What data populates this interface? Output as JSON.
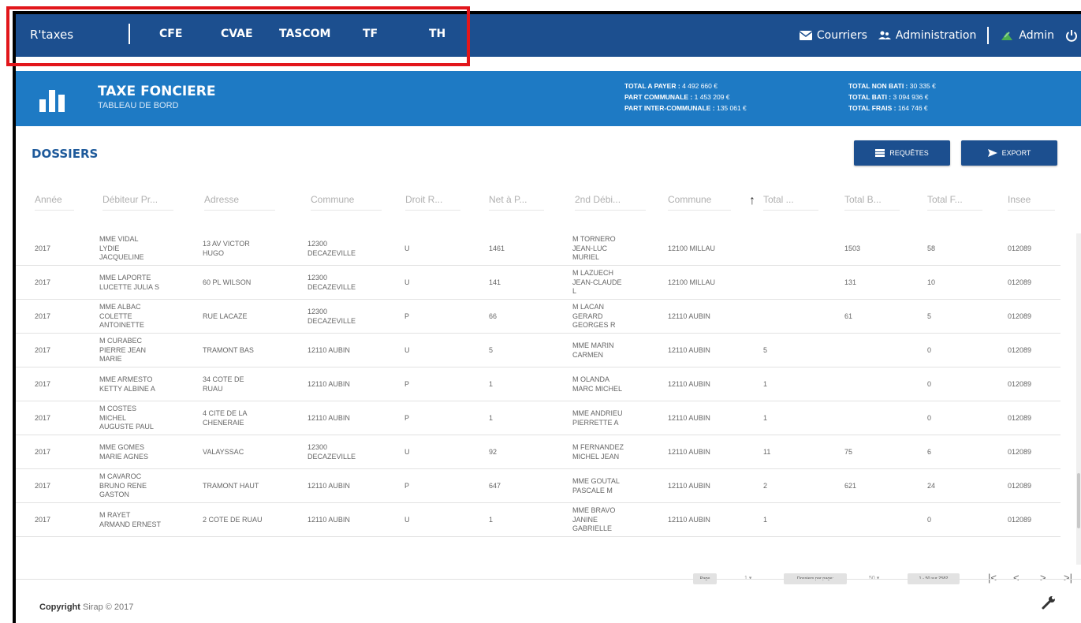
{
  "nav": {
    "brand": "R'taxes",
    "tabs": [
      "CFE",
      "CVAE",
      "TASCOM",
      "TF",
      "TH"
    ],
    "courriers": "Courriers",
    "administration": "Administration",
    "admin": "Admin"
  },
  "banner": {
    "title": "TAXE FONCIERE",
    "subtitle": "TABLEAU DE BORD",
    "totals_left": [
      {
        "label": "TOTAL A PAYER :",
        "value": "4 492 660 €"
      },
      {
        "label": "PART COMMUNALE :",
        "value": "1 453 209 €"
      },
      {
        "label": "PART INTER-COMMUNALE :",
        "value": "135 061 €"
      }
    ],
    "totals_right": [
      {
        "label": "TOTAL NON BATI :",
        "value": "30 335 €"
      },
      {
        "label": "TOTAL BATI :",
        "value": "3 094 936 €"
      },
      {
        "label": "TOTAL FRAIS :",
        "value": "164 746 €"
      }
    ]
  },
  "section": {
    "title": "DOSSIERS",
    "requetes_label": "REQUÊTES",
    "export_label": "EXPORT"
  },
  "table": {
    "headers": [
      "Année",
      "Débiteur Pr...",
      "Adresse",
      "Commune",
      "Droit R...",
      "Net à P...",
      "2nd Débi...",
      "Commune",
      "Total ...",
      "Total B...",
      "Total F...",
      "Insee"
    ],
    "rows": [
      [
        "2017",
        "MME VIDAL\nLYDIE\nJACQUELINE",
        "13 AV VICTOR\nHUGO",
        "12300\nDECAZEVILLE",
        "U",
        "1461",
        "M TORNERO\nJEAN-LUC\nMURIEL",
        "12100 MILLAU",
        "",
        "1503",
        "58",
        "012089"
      ],
      [
        "2017",
        "MME LAPORTE\nLUCETTE JULIA S",
        "60 PL WILSON",
        "12300\nDECAZEVILLE",
        "U",
        "141",
        "M LAZUECH\nJEAN-CLAUDE\nL",
        "12100 MILLAU",
        "",
        "131",
        "10",
        "012089"
      ],
      [
        "2017",
        "MME ALBAC\nCOLETTE\nANTOINETTE",
        "RUE LACAZE",
        "12300\nDECAZEVILLE",
        "P",
        "66",
        "M LACAN\nGERARD\nGEORGES R",
        "12110 AUBIN",
        "",
        "61",
        "5",
        "012089"
      ],
      [
        "2017",
        "M CURABEC\nPIERRE JEAN\nMARIE",
        "TRAMONT BAS",
        "12110 AUBIN",
        "U",
        "5",
        "MME MARIN\nCARMEN",
        "12110 AUBIN",
        "5",
        "",
        "0",
        "012089"
      ],
      [
        "2017",
        "MME ARMESTO\nKETTY ALBINE A",
        "34 COTE DE\nRUAU",
        "12110 AUBIN",
        "P",
        "1",
        "M OLANDA\nMARC MICHEL",
        "12110 AUBIN",
        "1",
        "",
        "0",
        "012089"
      ],
      [
        "2017",
        "M COSTES\nMICHEL\nAUGUSTE PAUL",
        "4 CITE DE LA\nCHENERAIE",
        "12110 AUBIN",
        "P",
        "1",
        "MME ANDRIEU\nPIERRETTE A",
        "12110 AUBIN",
        "1",
        "",
        "0",
        "012089"
      ],
      [
        "2017",
        "MME GOMES\nMARIE AGNES",
        "VALAYSSAC",
        "12300\nDECAZEVILLE",
        "U",
        "92",
        "M FERNANDEZ\nMICHEL JEAN",
        "12110 AUBIN",
        "11",
        "75",
        "6",
        "012089"
      ],
      [
        "2017",
        "M CAVAROC\nBRUNO RENE\nGASTON",
        "TRAMONT HAUT",
        "12110 AUBIN",
        "P",
        "647",
        "MME GOUTAL\nPASCALE M",
        "12110 AUBIN",
        "2",
        "621",
        "24",
        "012089"
      ],
      [
        "2017",
        "M RAYET\nARMAND ERNEST",
        "2 COTE DE RUAU",
        "12110 AUBIN",
        "U",
        "1",
        "MME BRAVO\nJANINE\nGABRIELLE",
        "12110 AUBIN",
        "1",
        "",
        "0",
        "012089"
      ]
    ]
  },
  "pager": {
    "page_label": "Page",
    "page_value": "1 ▾",
    "per_page_label": "Dossiers par page:",
    "per_page_value": "50 ▾",
    "range": "1 - 50 sur 2582"
  },
  "footer": {
    "copyright_bold": "Copyright",
    "copyright_rest": "Sirap © 2017"
  },
  "colors": {
    "nav_bg": "#1c4f8f",
    "banner_bg": "#1e7ac4",
    "accent_title": "#1e5a9b",
    "highlight": "#e2161b",
    "admin_icon": "#4caf50"
  }
}
